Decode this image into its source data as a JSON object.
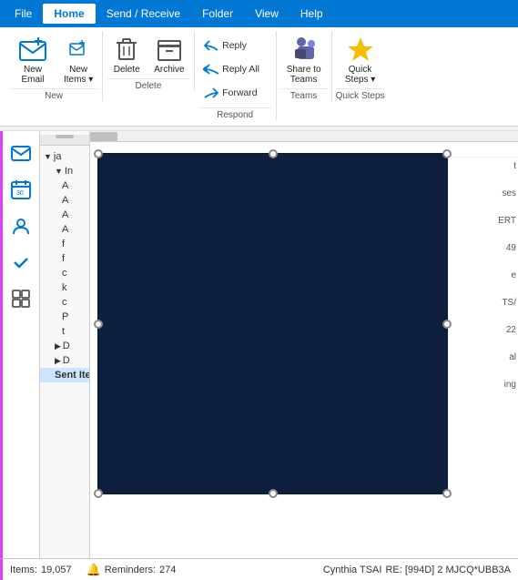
{
  "tabs": {
    "items": [
      "File",
      "Home",
      "Send / Receive",
      "Folder",
      "View",
      "Help"
    ],
    "active": "Home"
  },
  "ribbon": {
    "groups": [
      {
        "name": "New",
        "buttons": [
          {
            "id": "new-email",
            "label": "New\nEmail",
            "icon": "✉"
          },
          {
            "id": "new-items",
            "label": "New\nItems",
            "icon": "📋",
            "dropdown": true
          }
        ]
      },
      {
        "name": "Delete",
        "buttons": [
          {
            "id": "delete",
            "label": "Delete",
            "icon": "🗑"
          },
          {
            "id": "archive",
            "label": "Archive",
            "icon": "📦"
          }
        ]
      },
      {
        "name": "Respond",
        "buttons": [
          {
            "id": "reply",
            "label": "Reply",
            "icon": "↩"
          },
          {
            "id": "reply-all",
            "label": "Reply All",
            "icon": "↩↩"
          },
          {
            "id": "forward",
            "label": "Forward",
            "icon": "↪"
          }
        ]
      },
      {
        "name": "Teams",
        "buttons": [
          {
            "id": "share-to-teams",
            "label": "Share to\nTeams",
            "icon": "T"
          }
        ]
      },
      {
        "name": "Quick Steps",
        "buttons": [
          {
            "id": "quick-steps",
            "label": "Quick\nSteps",
            "icon": "⚡",
            "dropdown": true
          }
        ]
      }
    ]
  },
  "sidebar": {
    "icons": [
      {
        "id": "mail",
        "icon": "✉",
        "active": true
      },
      {
        "id": "calendar",
        "icon": "📅"
      },
      {
        "id": "people",
        "icon": "👤"
      },
      {
        "id": "check",
        "icon": "✔",
        "active": true
      },
      {
        "id": "apps",
        "icon": "⊞"
      }
    ]
  },
  "folders": {
    "tree": [
      {
        "label": "ja",
        "level": 0,
        "collapsed": false
      },
      {
        "label": "In",
        "level": 1,
        "collapsed": false
      },
      {
        "label": "A",
        "level": 2
      },
      {
        "label": "A",
        "level": 2
      },
      {
        "label": "A",
        "level": 2
      },
      {
        "label": "A",
        "level": 2
      },
      {
        "label": "f",
        "level": 2
      },
      {
        "label": "f",
        "level": 2
      },
      {
        "label": "c",
        "level": 2
      },
      {
        "label": "k",
        "level": 2
      },
      {
        "label": "c",
        "level": 2
      },
      {
        "label": "P",
        "level": 2
      },
      {
        "label": "t",
        "level": 2
      },
      {
        "label": "D",
        "level": 1
      },
      {
        "label": "D",
        "level": 1,
        "collapsed": false
      },
      {
        "label": "Sent Items",
        "level": 1
      }
    ]
  },
  "right_snippets": [
    "t",
    "ses",
    "ERT",
    "49",
    "e",
    "TS/",
    "22",
    "al",
    "ing"
  ],
  "status_bar": {
    "items_label": "Items:",
    "items_count": "19,057",
    "reminders_icon": "🔔",
    "reminders_label": "Reminders:",
    "reminders_count": "274"
  },
  "bottom_right": {
    "sender": "Cynthia TSAI",
    "subject": "RE: [994D] 2 MJCQ*UBB3A"
  },
  "selected_folder": "Sent Items"
}
